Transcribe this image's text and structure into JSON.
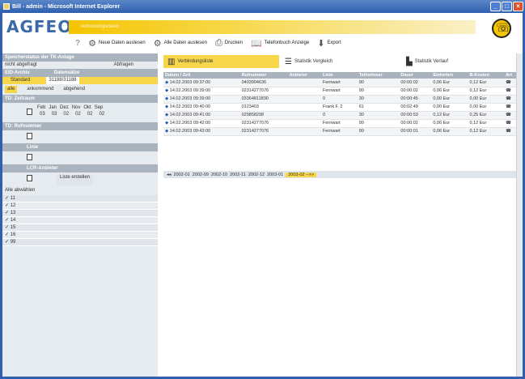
{
  "window": {
    "title": "Bill - admin - Microsoft Internet Explorer"
  },
  "header": {
    "logo": "AGFEO",
    "banner_sub": "Verbindungsdaten",
    "toolbar": [
      {
        "icon": "gear-icon",
        "label": "Neue Daten auslesen"
      },
      {
        "icon": "gear-icon",
        "label": "Alle Daten auslesen"
      },
      {
        "icon": "printer-icon",
        "label": "Drucken"
      },
      {
        "icon": "book-icon",
        "label": "Telefonbuch Anzeige"
      },
      {
        "icon": "export-icon",
        "label": "Export"
      }
    ]
  },
  "left": {
    "storage_header": "Speicherstatus der TK-Anlage",
    "storage_status": "nicht abgefragt",
    "storage_action": "Abfragen",
    "eid_header": "EID-Archiv",
    "eid_col2": "Datensätze",
    "eid_row_name": "Standard",
    "eid_row_value": "31188/31188",
    "dir_all": "alle",
    "dir_in": "ankommend",
    "dir_out": "abgehend",
    "zeitraum_header": "TD: Zeitraum",
    "months": [
      "Feb",
      "Jan",
      "Dez",
      "Nov",
      "Okt",
      "Sep"
    ],
    "month_nums": [
      "03",
      "03",
      "02",
      "02",
      "02",
      "02"
    ],
    "rufnummer_header": "TD: Rufnummer",
    "teiln_header": "Linie",
    "lcr_header": "LCR-Anbieter",
    "liste_erstellen": "Liste erstellen",
    "alle_auswaehlen": "Alle abwählen",
    "lines": [
      "11",
      "12",
      "13",
      "14",
      "15",
      "16",
      "99"
    ]
  },
  "main": {
    "tabs": [
      {
        "label": "Verbindungsliste"
      },
      {
        "label": "Statistik Vergleich"
      },
      {
        "label": "Statistik Verlauf"
      }
    ],
    "columns": [
      "Datum / Zeit",
      "Rufnummer",
      "Anbieter",
      "Linie",
      "Teilnehmer",
      "Dauer",
      "Einheiten",
      "B-Kosten",
      "Art"
    ],
    "rows": [
      [
        "14.02.2003 09:37:00",
        "0403904636",
        "",
        "Fernwart",
        "90",
        "00:00:02",
        "0,06 Eur",
        "0,12 Eur",
        ""
      ],
      [
        "14.02.2003 09:39:00",
        "02314277076",
        "",
        "Fernwart",
        "90",
        "00:00:02",
        "0,06 Eur",
        "0,12 Eur",
        ""
      ],
      [
        "14.02.2003 09:39:00",
        "03364811830",
        "",
        "0",
        "30",
        "00:00:45",
        "0,00 Eur",
        "0,00 Eur",
        ""
      ],
      [
        "14.02.2003 09:40:00",
        "0123403",
        "",
        "Frank F. 2",
        "61",
        "00:02:49",
        "0,00 Eur",
        "0,00 Eur",
        ""
      ],
      [
        "14.02.2003 09:41:00",
        "029858298",
        "",
        "0",
        "30",
        "00:00:53",
        "0,12 Eur",
        "0,25 Eur",
        ""
      ],
      [
        "14.02.2003 09:42:00",
        "02314277076",
        "",
        "Fernwart",
        "90",
        "00:00:02",
        "0,06 Eur",
        "0,12 Eur",
        ""
      ],
      [
        "14.02.2003 09:43:00",
        "02314277076",
        "",
        "Fernwart",
        "90",
        "00:00:01",
        "0,06 Eur",
        "0,12 Eur",
        ""
      ]
    ],
    "pager": {
      "pages": [
        "2002-01",
        "2002-09",
        "2002-10",
        "2002-11",
        "2002-12",
        "2003-01"
      ],
      "current": "2003-02 -->>"
    }
  }
}
